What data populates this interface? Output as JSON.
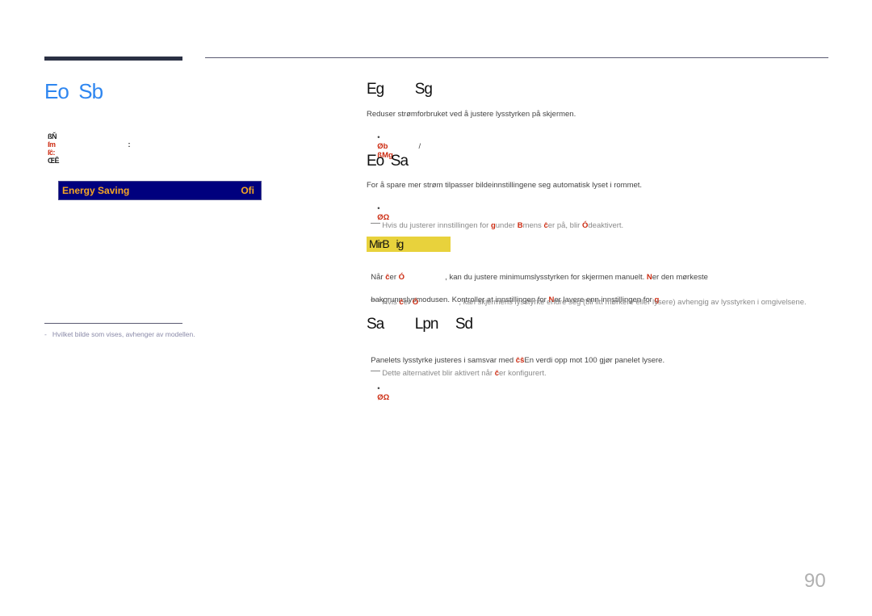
{
  "header": {
    "title": "Eo  Sb",
    "path": {
      "part1": "ßŇ",
      "part2": "ſm",
      "sep": ":",
      "part3": "ſĉ:",
      "part4": "ŒĒ"
    }
  },
  "osd_menu": {
    "label": "Energy Saving",
    "value": "Ofi"
  },
  "footnote": "-   Hvilket bilde som vises, avhenger av modellen.",
  "sections": {
    "energy_saving": {
      "heading": "Eg         Sg",
      "text": "Reduser strømforbruket ved å justere lysstyrken på skjermen.",
      "bullet": {
        "opt1": "Øb",
        "sep": "/",
        "opt2": "ßMg"
      }
    },
    "eco_sensor": {
      "heading": "Eo  Sa",
      "text": "For å spare mer strøm tilpasser bildeinnstillingene seg automatisk lyset i rommet.",
      "bullet": "ØΩ",
      "note": {
        "pre": "Hvis du justerer innstillingen for ",
        "r1": "g",
        "mid1": "under ",
        "r2": "B",
        "mid2": "mens ",
        "r3": "ĉ",
        "mid3": "er på, blir ",
        "r4": "Ó",
        "post": "deaktivert."
      }
    },
    "min_backlight": {
      "heading": "MirB   ig",
      "para1": {
        "pre": "Når ",
        "r1": "ĉ",
        "mid1": "er ",
        "r2": "Ó",
        "mid2": "                   , kan du justere minimumslysstyrken for skjermen manuelt. ",
        "r3": "N",
        "post": "er den mørkeste"
      },
      "para2": {
        "pre": "bakgrunnslysmodusen. Kontroller at innstillingen for ",
        "r1": "N",
        "mid": "er lavere enn innstillingen for ",
        "r2": "g"
      },
      "note": {
        "pre": "Hvis ",
        "r1": "ĉ",
        "mid": "er ",
        "r2": "Ó",
        "post": "                   , kan skjermens lysstyrke endre seg (bli litt mørkere eller lysere) avhengig av lysstyrken i omgivelsene."
      }
    },
    "screen_lamp": {
      "heading": "Sa         Lpn     Sd",
      "text": {
        "pre": "Panelets lysstyrke justeres i samsvar med ",
        "r1": "ĉŝ",
        "post": "En verdi opp mot 100 gjør panelet lysere."
      },
      "note": {
        "pre": "Dette alternativet blir aktivert når ",
        "r1": "ĉ",
        "post": "er konfigurert."
      },
      "bullet": "ØΩ"
    }
  },
  "page_number": "90"
}
